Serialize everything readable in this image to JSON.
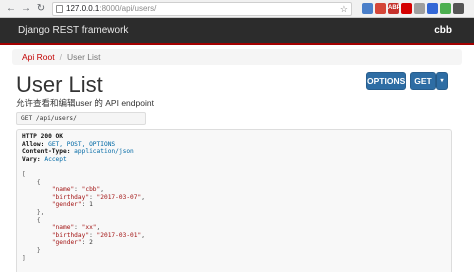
{
  "browser": {
    "url_host": "127.0.0.1",
    "url_rest": ":8000/api/users/",
    "extensions": [
      {
        "name": "sync-extension",
        "color": "#4a7fc9",
        "label": ""
      },
      {
        "name": "mail-extension",
        "color": "#d44638",
        "label": ""
      },
      {
        "name": "abp-extension",
        "color": "#c4302b",
        "label": "ABP"
      },
      {
        "name": "red-extension",
        "color": "#d40000",
        "label": ""
      },
      {
        "name": "grey-extension",
        "color": "#9e9e9e",
        "label": ""
      },
      {
        "name": "blue-extension",
        "color": "#3367d6",
        "label": ""
      },
      {
        "name": "green-extension",
        "color": "#4caf50",
        "label": ""
      },
      {
        "name": "dark-extension",
        "color": "#555555",
        "label": ""
      }
    ]
  },
  "navbar": {
    "brand": "Django REST framework",
    "user": "cbb"
  },
  "breadcrumb": {
    "root": "Api Root",
    "separator": "/",
    "current": "User List"
  },
  "page": {
    "title": "User List",
    "description": "允许查看和编辑user 的 API endpoint",
    "options_button": "OPTIONS",
    "get_button": "GET",
    "caret": "▾"
  },
  "request": {
    "text": "GET /api/users/"
  },
  "response": {
    "status": "HTTP 200 OK",
    "headers": [
      {
        "name": "Allow:",
        "value": "GET, POST, OPTIONS"
      },
      {
        "name": "Content-Type:",
        "value": "application/json"
      },
      {
        "name": "Vary:",
        "value": "Accept"
      }
    ],
    "body": {
      "open_bracket": "[",
      "users": [
        {
          "name_key": "\"name\"",
          "name_val": "\"cbb\"",
          "birthday_key": "\"birthday\"",
          "birthday_val": "\"2017-03-07\"",
          "gender_key": "\"gender\"",
          "gender_val": "1"
        },
        {
          "name_key": "\"name\"",
          "name_val": "\"xx\"",
          "birthday_key": "\"birthday\"",
          "birthday_val": "\"2017-03-01\"",
          "gender_key": "\"gender\"",
          "gender_val": "2"
        }
      ],
      "close_bracket": "]"
    }
  }
}
